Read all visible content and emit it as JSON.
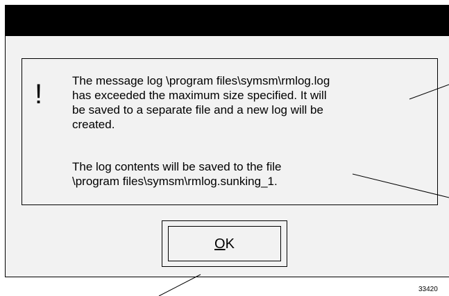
{
  "dialog": {
    "icon": "exclamation-icon",
    "icon_glyph": "!",
    "message_1": [
      "The message log \\program files\\symsm\\rmlog.log",
      "has exceeded the maximum size specified. It will",
      "be saved to a separate file and a new log will be",
      "created."
    ],
    "message_2": [
      "The log contents will be saved to the file",
      "\\program files\\symsm\\rmlog.sunking_1."
    ],
    "ok_button": {
      "mnemonic": "O",
      "rest": "K"
    }
  },
  "figure_number": "33420"
}
